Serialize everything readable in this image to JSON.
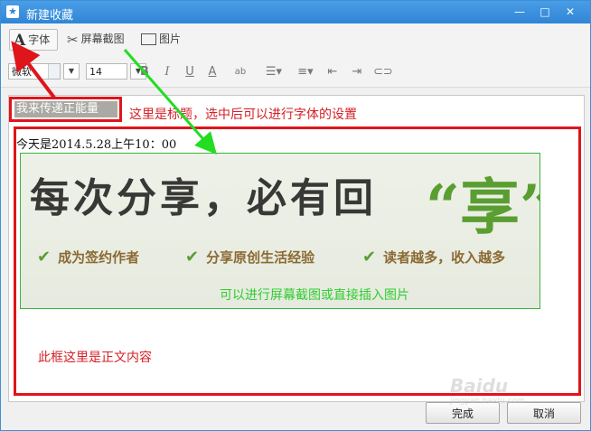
{
  "window": {
    "title": "新建收藏",
    "app_icon": "star-icon",
    "controls": {
      "minimize": "—",
      "maximize": "□",
      "close": "✕"
    }
  },
  "toolbar": {
    "font_label": "字体",
    "screenshot_label": "屏幕截图",
    "picture_label": "图片"
  },
  "format": {
    "font_family": "微软",
    "font_size": "14",
    "bold": "B",
    "italic": "I",
    "underline": "U",
    "font_color": "A",
    "background_color": "ab"
  },
  "editor": {
    "title_value": "我来传递正能量",
    "body_first_line": "今天是2014.5.28上午10：00"
  },
  "banner": {
    "slogan": "每次分享，必有回",
    "slogan_highlight": "“享”",
    "features": [
      "成为签约作者",
      "分享原创生活经验",
      "读者越多，收入越多"
    ],
    "check_icon": "checkmark-icon",
    "note": "可以进行屏幕截图或直接插入图片"
  },
  "annotations": {
    "title_hint": "这里是标题，选中后可以进行字体的设置",
    "body_hint": "此框这里是正文内容",
    "highlight_color": "#e0141b",
    "arrow_red": "#e0141b",
    "arrow_green": "#22dd22"
  },
  "buttons": {
    "done": "完成",
    "cancel": "取消"
  },
  "watermark": {
    "brand": "Baidu",
    "sub": "jingyan.baidu.com"
  }
}
